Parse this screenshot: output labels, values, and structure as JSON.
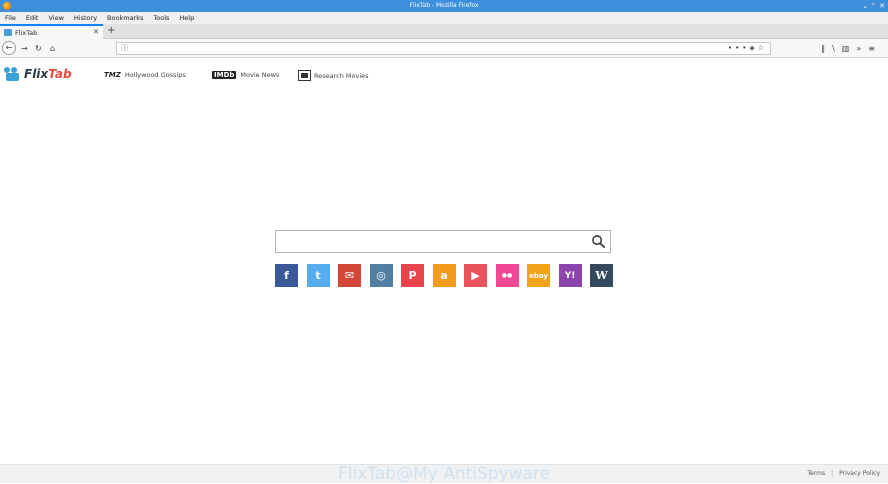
{
  "window": {
    "title": "FlixTab - Mozilla Firefox"
  },
  "menu": [
    "File",
    "Edit",
    "View",
    "History",
    "Bookmarks",
    "Tools",
    "Help"
  ],
  "tab": {
    "label": "FlixTab"
  },
  "urlbar": {
    "value": ""
  },
  "logo": {
    "flix": "Flix",
    "tab": "Tab"
  },
  "toplinks": [
    {
      "icon": "TMZ",
      "label": "Hollywood Gossips"
    },
    {
      "icon": "IMDb",
      "label": "Movie News"
    },
    {
      "icon": "film-icon",
      "label": "Research Movies"
    }
  ],
  "search": {
    "placeholder": ""
  },
  "socials": [
    {
      "name": "facebook",
      "glyph": "f",
      "color": "#3b5998"
    },
    {
      "name": "twitter",
      "glyph": "t",
      "color": "#55acee"
    },
    {
      "name": "mail",
      "glyph": "✉",
      "color": "#d44638"
    },
    {
      "name": "instagram",
      "glyph": "◎",
      "color": "#517fa4"
    },
    {
      "name": "pinterest",
      "glyph": "P",
      "color": "#e9434b"
    },
    {
      "name": "amazon",
      "glyph": "a",
      "color": "#f29b1d"
    },
    {
      "name": "youtube",
      "glyph": "▶",
      "color": "#e9545a"
    },
    {
      "name": "flickr",
      "glyph": "●●",
      "color": "#f04894"
    },
    {
      "name": "ebay",
      "glyph": "ebay",
      "color": "#f3a21b"
    },
    {
      "name": "yahoo",
      "glyph": "Y!",
      "color": "#8e44ad"
    },
    {
      "name": "wikipedia",
      "glyph": "W",
      "color": "#34495e"
    }
  ],
  "footer": {
    "watermark": "FlixTab@My AntiSpyware",
    "terms": "Terms",
    "privacy": "Privacy Policy"
  }
}
